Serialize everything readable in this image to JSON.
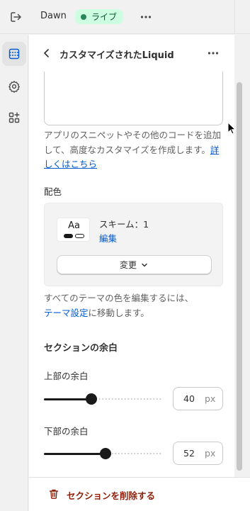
{
  "topbar": {
    "exit_icon": "exit-icon",
    "theme_name": "Dawn",
    "live_badge": "ライブ",
    "more_icon": "more-horizontal-icon"
  },
  "rail": {
    "items": [
      {
        "icon": "sections-icon",
        "active": true
      },
      {
        "icon": "settings-gear-icon",
        "active": false
      },
      {
        "icon": "apps-add-icon",
        "active": false
      }
    ]
  },
  "panel": {
    "title": "カスタマイズされたLiquid",
    "back_icon": "chevron-left-icon",
    "more_icon": "more-horizontal-icon",
    "liquid_textarea": "",
    "help_text": "アプリのスニペットやその他のコードを追加して、高度なカスタマイズを作成します。",
    "help_link": "詳しくはこちら",
    "color_label": "配色",
    "scheme": {
      "swatch_text": "Aa",
      "name": "スキーム：1",
      "edit_label": "編集",
      "change_label": "変更"
    },
    "theme_text_before": "すべてのテーマの色を編集するには、",
    "theme_link": "テーマ設定",
    "theme_text_after": "に移動します。",
    "spacing_heading": "セクションの余白",
    "top_padding": {
      "label": "上部の余白",
      "value": "40",
      "unit": "px",
      "fraction": 0.4
    },
    "bottom_padding": {
      "label": "下部の余白",
      "value": "52",
      "unit": "px",
      "fraction": 0.52
    }
  },
  "footer": {
    "delete_label": "セクションを削除する",
    "trash_icon": "trash-icon"
  },
  "colors": {
    "accent_link": "#005bd3",
    "live_badge_bg": "#cdfee1",
    "danger": "#8e1f0b"
  }
}
